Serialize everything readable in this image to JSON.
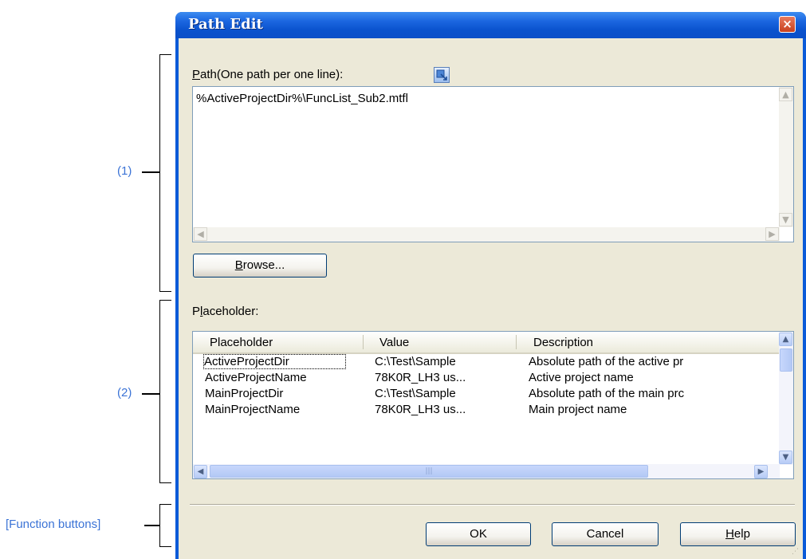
{
  "annotations": {
    "section1": "(1)",
    "section2": "(2)",
    "function_buttons": "[Function buttons]"
  },
  "window": {
    "title": "Path Edit",
    "close_glyph": "×"
  },
  "path_section": {
    "label_prefix": "P",
    "label_rest": "ath(One path per one line):",
    "insert_icon": "placeholder-insert-icon",
    "value": "%ActiveProjectDir%\\FuncList_Sub2.mtfl",
    "browse_prefix": "B",
    "browse_rest": "rowse..."
  },
  "placeholder_section": {
    "label_first": "P",
    "label_mnemonic": "l",
    "label_rest": "aceholder:",
    "columns": [
      "Placeholder",
      "Value",
      "Description"
    ],
    "rows": [
      {
        "placeholder": "ActiveProjectDir",
        "value": "C:\\Test\\Sample",
        "description": "Absolute path of the active pr"
      },
      {
        "placeholder": "ActiveProjectName",
        "value": "78K0R_LH3 us...",
        "description": "Active project name"
      },
      {
        "placeholder": "MainProjectDir",
        "value": "C:\\Test\\Sample",
        "description": "Absolute path of the main prc"
      },
      {
        "placeholder": "MainProjectName",
        "value": "78K0R_LH3 us...",
        "description": "Main project name"
      }
    ]
  },
  "buttons": {
    "ok": "OK",
    "cancel": "Cancel",
    "help_prefix": "H",
    "help_rest": "elp"
  },
  "colors": {
    "annotation": "#3b73d6",
    "titlebar": "#0a52cd",
    "dialog_bg": "#ece9d8"
  }
}
